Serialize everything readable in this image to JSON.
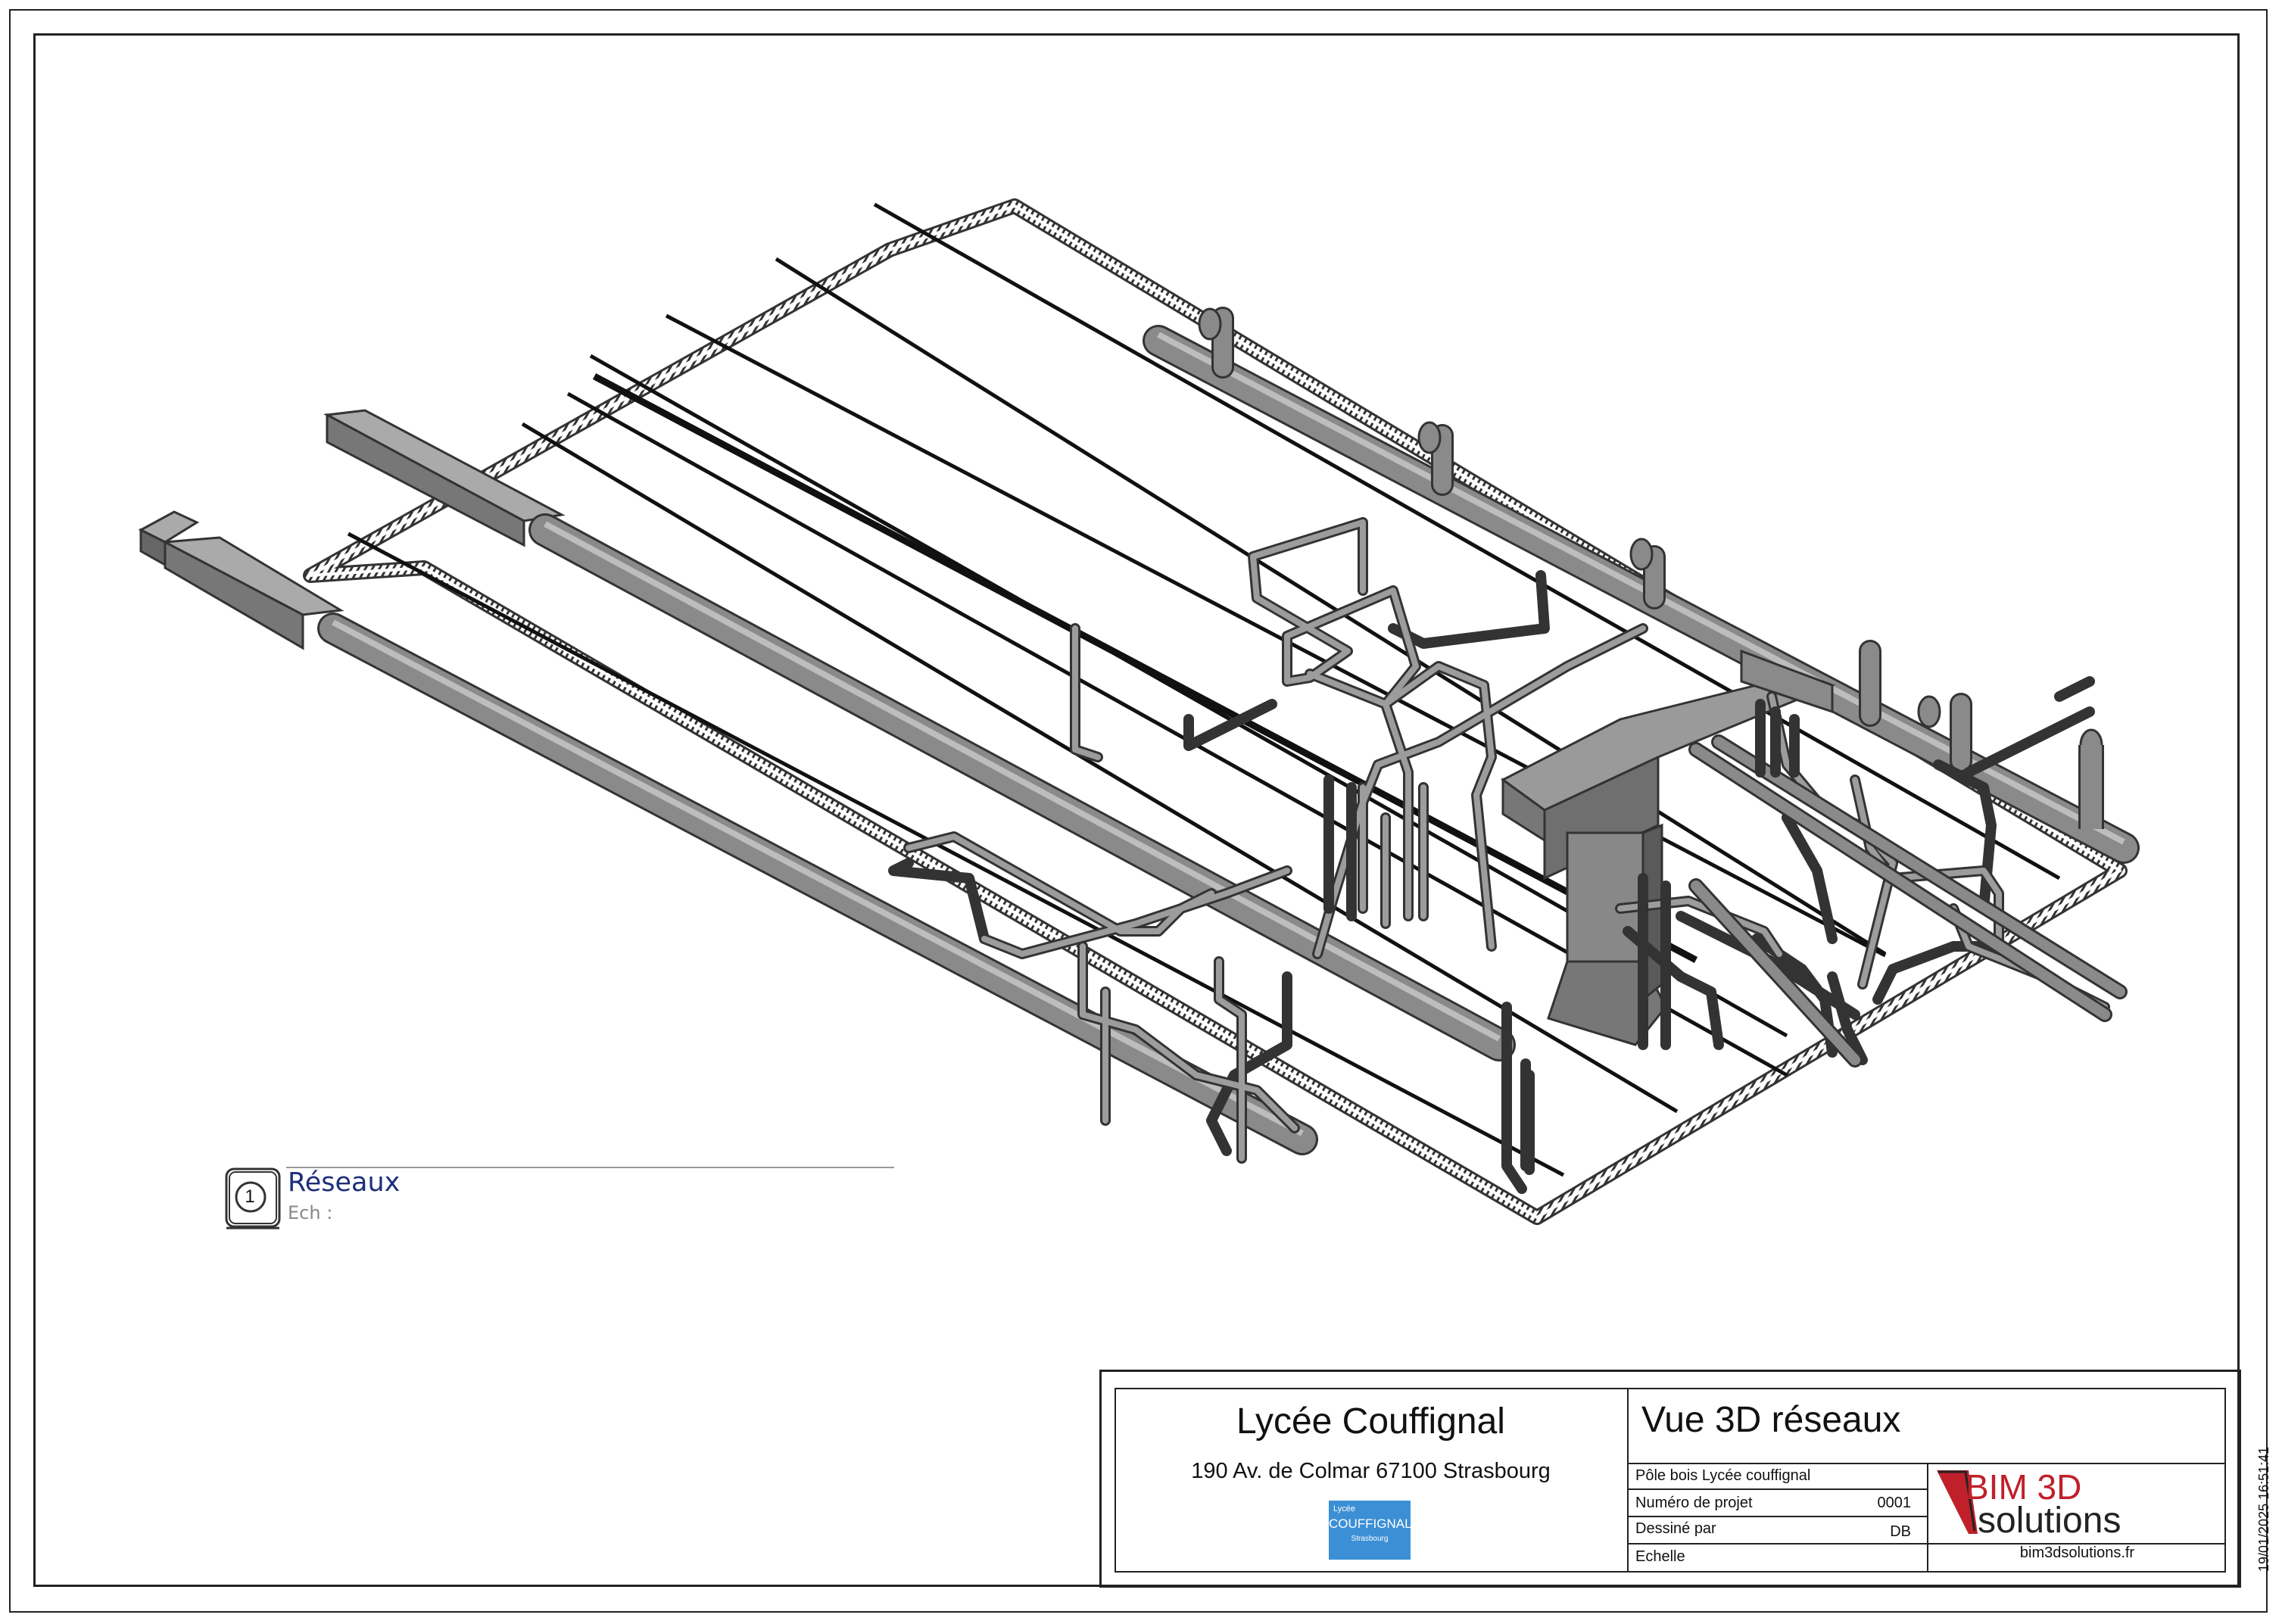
{
  "view": {
    "number": "1",
    "title": "Réseaux",
    "scale_label": "Ech :"
  },
  "title_block": {
    "client_name": "Lycée Couffignal",
    "client_address": "190 Av. de Colmar 67100 Strasbourg",
    "school_logo": {
      "line1": "Lycée",
      "line2": "COUFFIGNAL",
      "line3": "Strasbourg",
      "color": "#3c8fd4"
    },
    "sheet_title": "Vue 3D réseaux",
    "project_name": "Pôle bois Lycée couffignal",
    "fields": [
      {
        "label": "Numéro de projet",
        "value": "0001"
      },
      {
        "label": "Dessiné par",
        "value": "DB"
      },
      {
        "label": "Echelle",
        "value": ""
      }
    ],
    "company_logo": {
      "line1": "BIM 3D",
      "line2": "solutions",
      "accent_color": "#c0202a"
    },
    "website": "bim3dsolutions.fr",
    "print_date": "19/01/2025 16:51:41"
  }
}
